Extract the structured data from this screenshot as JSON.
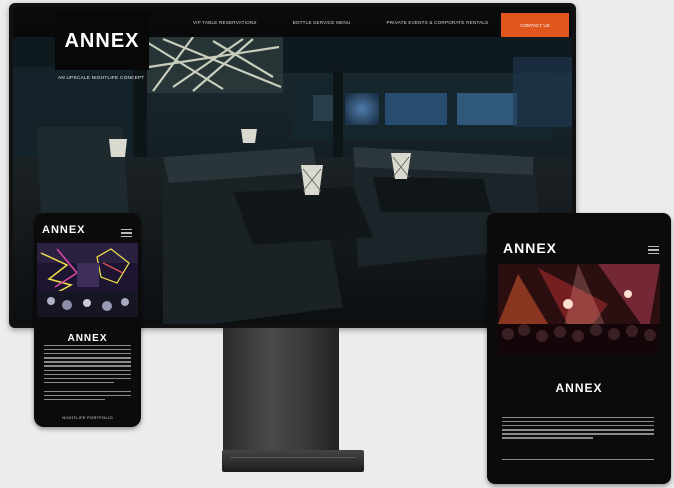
{
  "brand": {
    "logo_text": "ANNEX",
    "accent": "#e0561d"
  },
  "desktop": {
    "nav": [
      {
        "label": "VIP TABLE RESERVATIONS"
      },
      {
        "label": "BOTTLE SERVICE MENU"
      },
      {
        "label": "PRIVATE EVENTS & CORPORATE RENTALS"
      }
    ],
    "cta_label": "CONTACT US",
    "tagline": "AN UPSCALE NIGHTLIFE CONCEPT"
  },
  "phone": {
    "menu_icon": "hamburger-icon",
    "cta_label": "NIGHTLIFE PORTFOLIO"
  },
  "tablet": {
    "menu_icon": "hamburger-icon"
  }
}
